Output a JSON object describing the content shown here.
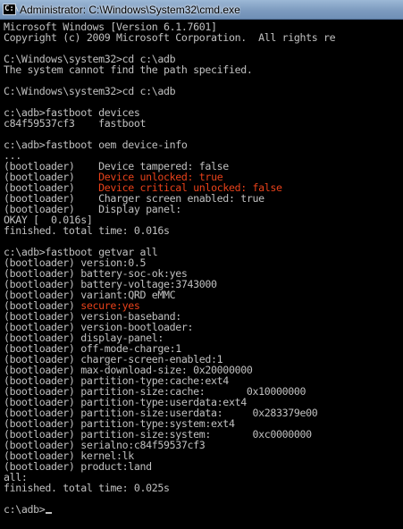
{
  "window": {
    "title": "Administrator: C:\\Windows\\System32\\cmd.exe",
    "icon": "cmd-prompt-icon",
    "icon_glyph": "C:\\"
  },
  "colors": {
    "background": "#000000",
    "text": "#c0c0c0",
    "highlight": "#e8411a",
    "titlebar": "#7d9bbf"
  },
  "console": {
    "lines": [
      {
        "text": "Microsoft Windows [Version 6.1.7601]"
      },
      {
        "text": "Copyright (c) 2009 Microsoft Corporation.  All rights re"
      },
      {
        "text": ""
      },
      {
        "text": "C:\\Windows\\system32>cd c:\\adb"
      },
      {
        "text": "The system cannot find the path specified."
      },
      {
        "text": ""
      },
      {
        "text": "C:\\Windows\\system32>cd c:\\adb"
      },
      {
        "text": ""
      },
      {
        "text": "c:\\adb>fastboot devices"
      },
      {
        "text": "c84f59537cf3    fastboot"
      },
      {
        "text": ""
      },
      {
        "text": "c:\\adb>fastboot oem device-info"
      },
      {
        "text": "..."
      },
      {
        "text": "(bootloader)    Device tampered: false"
      },
      {
        "text": "(bootloader)    Device unlocked: true",
        "hl_prefix": "(bootloader)    ",
        "hl_text": "Device unlocked: true"
      },
      {
        "text": "(bootloader)    Device critical unlocked: false",
        "hl_prefix": "(bootloader)    ",
        "hl_text": "Device critical unlocked: false"
      },
      {
        "text": "(bootloader)    Charger screen enabled: true"
      },
      {
        "text": "(bootloader)    Display panel:"
      },
      {
        "text": "OKAY [  0.016s]"
      },
      {
        "text": "finished. total time: 0.016s"
      },
      {
        "text": ""
      },
      {
        "text": "c:\\adb>fastboot getvar all"
      },
      {
        "text": "(bootloader) version:0.5"
      },
      {
        "text": "(bootloader) battery-soc-ok:yes"
      },
      {
        "text": "(bootloader) battery-voltage:3743000"
      },
      {
        "text": "(bootloader) variant:QRD eMMC"
      },
      {
        "text": "(bootloader) secure:yes",
        "hl_prefix": "(bootloader) ",
        "hl_text": "secure:yes"
      },
      {
        "text": "(bootloader) version-baseband:"
      },
      {
        "text": "(bootloader) version-bootloader:"
      },
      {
        "text": "(bootloader) display-panel:"
      },
      {
        "text": "(bootloader) off-mode-charge:1"
      },
      {
        "text": "(bootloader) charger-screen-enabled:1"
      },
      {
        "text": "(bootloader) max-download-size: 0x20000000"
      },
      {
        "text": "(bootloader) partition-type:cache:ext4"
      },
      {
        "text": "(bootloader) partition-size:cache:       0x10000000"
      },
      {
        "text": "(bootloader) partition-type:userdata:ext4"
      },
      {
        "text": "(bootloader) partition-size:userdata:     0x283379e00"
      },
      {
        "text": "(bootloader) partition-type:system:ext4"
      },
      {
        "text": "(bootloader) partition-size:system:       0xc0000000"
      },
      {
        "text": "(bootloader) serialno:c84f59537cf3"
      },
      {
        "text": "(bootloader) kernel:lk"
      },
      {
        "text": "(bootloader) product:land"
      },
      {
        "text": "all:"
      },
      {
        "text": "finished. total time: 0.025s"
      },
      {
        "text": ""
      },
      {
        "text": "c:\\adb>",
        "cursor": true
      }
    ]
  }
}
